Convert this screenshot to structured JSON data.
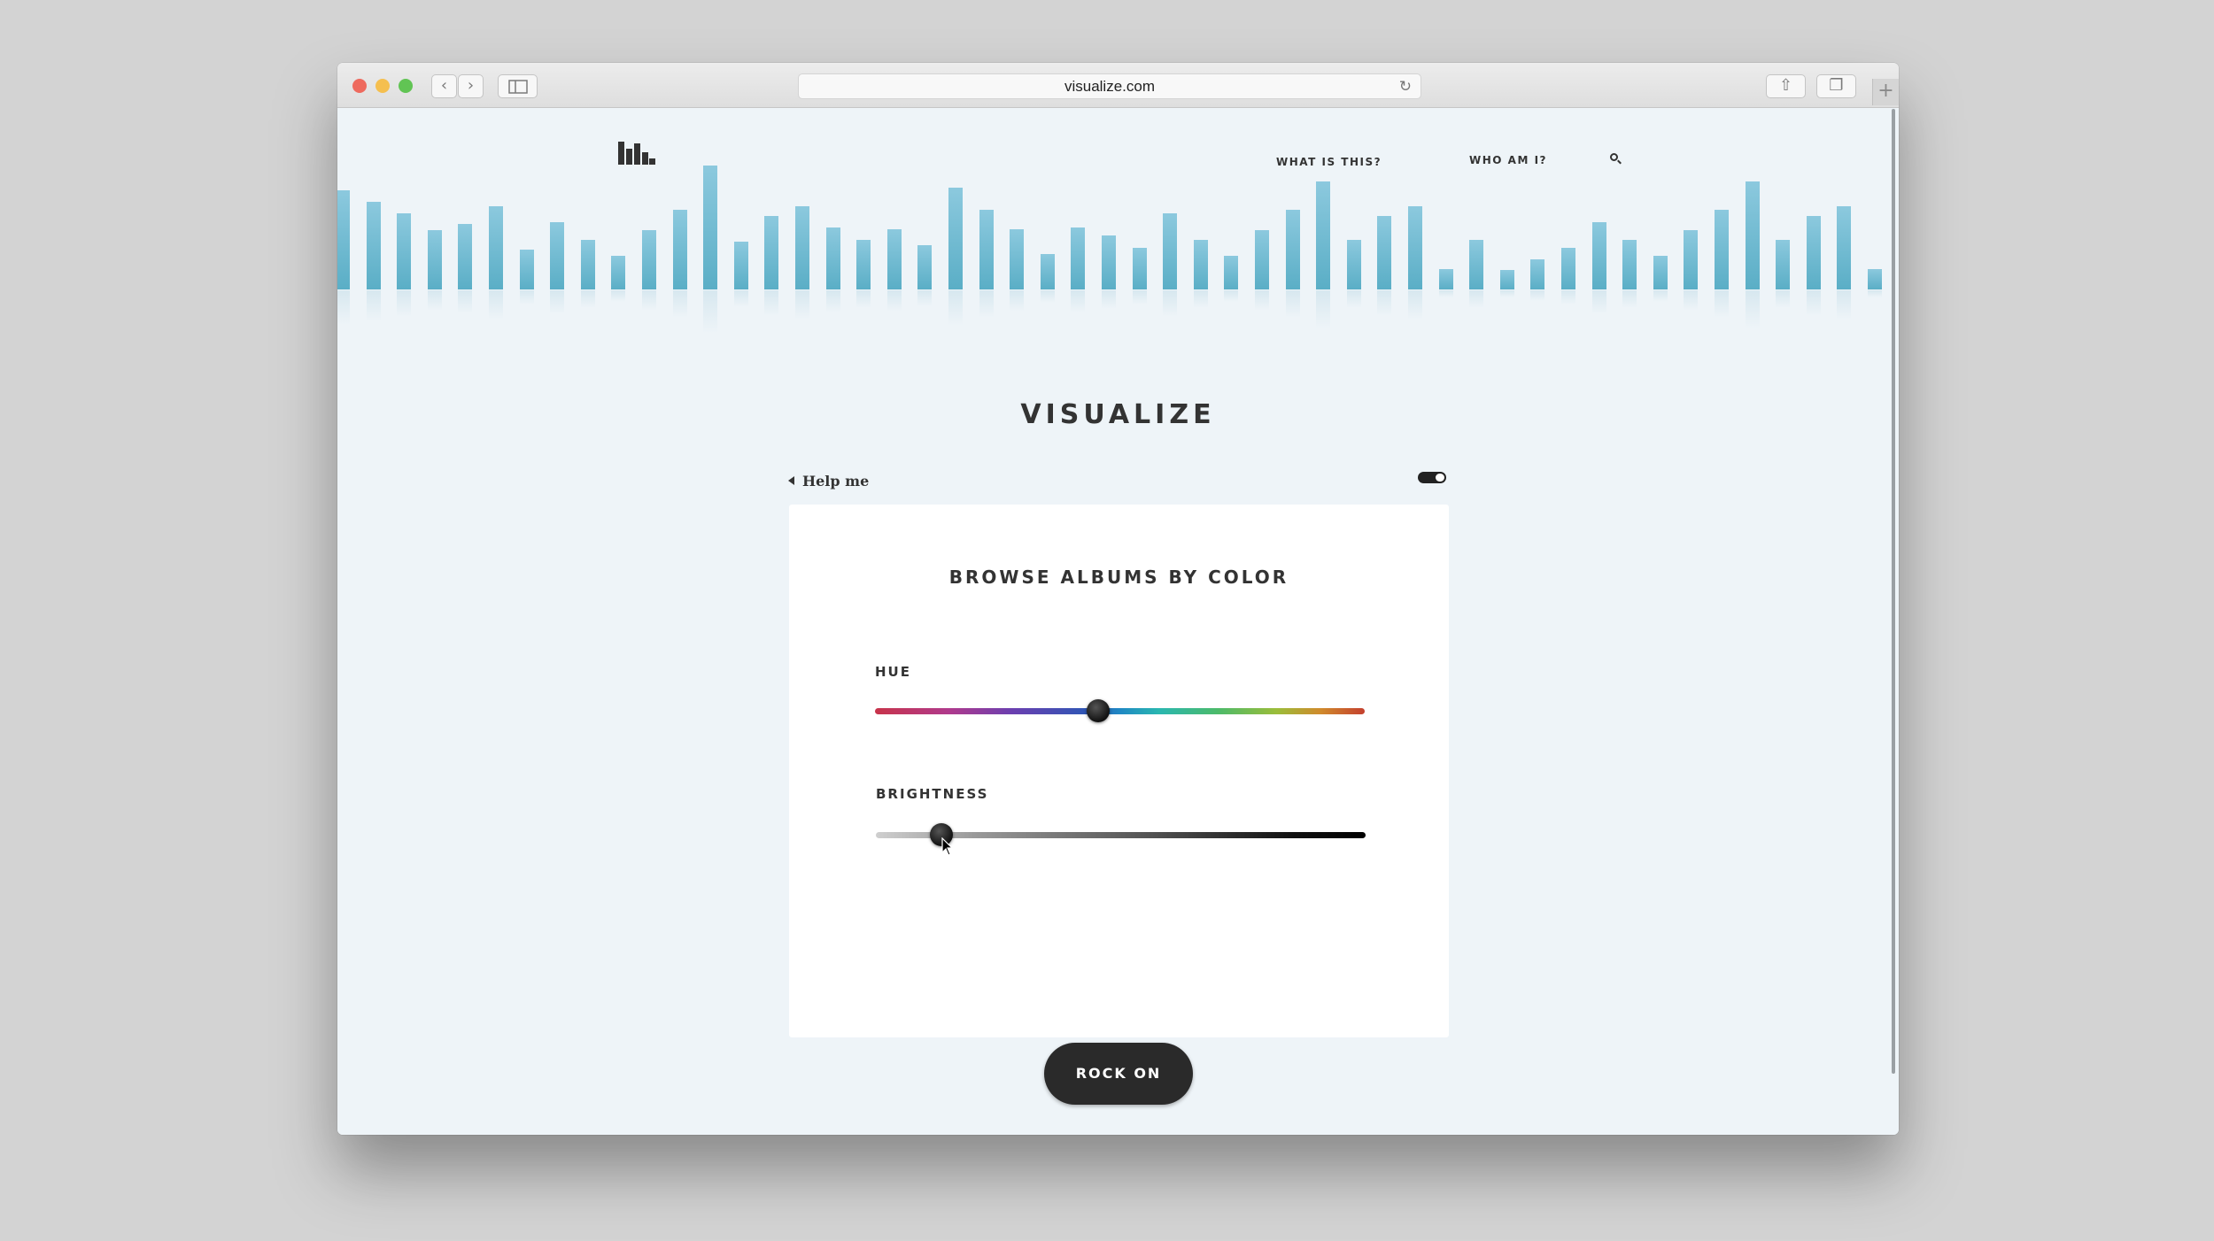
{
  "browser": {
    "url": "visualize.com",
    "back_icon": "chevron-left-icon",
    "forward_icon": "chevron-right-icon",
    "sidebar_icon": "sidebar-icon",
    "reload_icon": "reload-icon",
    "share_icon": "share-icon",
    "tabs_icon": "tabs-icon",
    "new_tab_icon": "plus-icon",
    "back_glyph": "‹",
    "forward_glyph": "›",
    "reload_glyph": "↻",
    "share_glyph": "⇧",
    "tabs_glyph": "❐",
    "new_tab_glyph": "+"
  },
  "nav": {
    "what_is_this": "WHAT IS THIS?",
    "who_am_i": "WHO AM I?",
    "search_icon": "search-icon"
  },
  "visualizer": {
    "bar_color": "#6ab8d0",
    "levels": [
      0.62,
      0.55,
      0.48,
      0.37,
      0.41,
      0.52,
      0.25,
      0.42,
      0.31,
      0.21,
      0.37,
      0.5,
      0.78,
      0.3,
      0.46,
      0.52,
      0.39,
      0.31,
      0.38,
      0.28,
      0.64,
      0.5,
      0.38,
      0.22,
      0.39,
      0.34,
      0.26,
      0.48,
      0.31,
      0.21,
      0.37,
      0.5,
      0.68,
      0.31,
      0.46,
      0.52,
      0.13,
      0.31,
      0.12,
      0.19,
      0.26,
      0.42,
      0.31,
      0.21,
      0.37,
      0.5,
      0.68,
      0.31,
      0.46,
      0.52,
      0.13
    ]
  },
  "site_title": "VISUALIZE",
  "help_link": "Help me",
  "toggle": {
    "on": true
  },
  "card": {
    "title": "BROWSE ALBUMS BY COLOR",
    "hue": {
      "label": "HUE",
      "value": 0.455
    },
    "brightness": {
      "label": "BRIGHTNESS",
      "value": 0.135
    },
    "button": "ROCK ON"
  }
}
